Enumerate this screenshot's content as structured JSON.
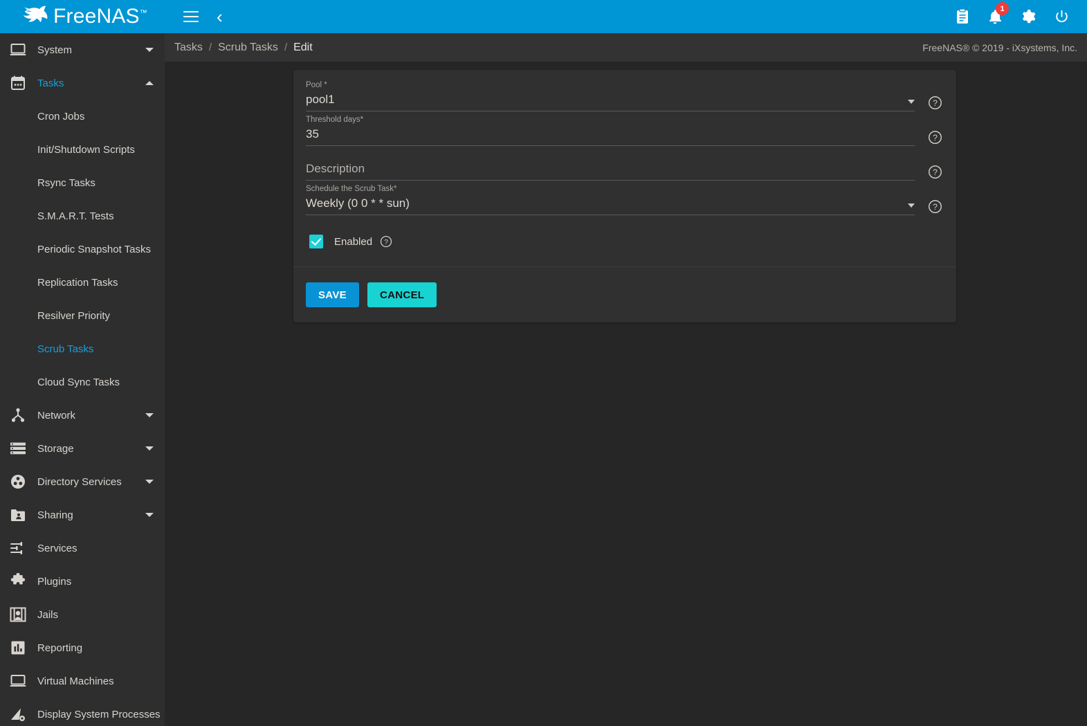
{
  "app": {
    "brand": "FreeNAS",
    "brand_tm": "™",
    "accent_blue": "#0095d5",
    "accent_cyan": "#19d2d2",
    "badge_red": "#f23b3b",
    "active_link": "#1a9fd9"
  },
  "topbar": {
    "menu_icon": "hamburger-icon",
    "collapse_icon": "chevron-left-icon",
    "icons": [
      {
        "name": "clipboard-icon",
        "label": "Tasks / Jobs"
      },
      {
        "name": "bell-icon",
        "label": "Alerts",
        "badge": "1"
      },
      {
        "name": "gear-icon",
        "label": "Settings"
      },
      {
        "name": "power-icon",
        "label": "Power"
      }
    ]
  },
  "sidebar": {
    "items": [
      {
        "label": "System",
        "icon": "monitor-icon",
        "expandable": true,
        "expanded": false,
        "active": false
      },
      {
        "label": "Tasks",
        "icon": "calendar-icon",
        "expandable": true,
        "expanded": true,
        "active": true
      }
    ],
    "task_children": [
      {
        "label": "Cron Jobs",
        "active": false
      },
      {
        "label": "Init/Shutdown Scripts",
        "active": false
      },
      {
        "label": "Rsync Tasks",
        "active": false
      },
      {
        "label": "S.M.A.R.T. Tests",
        "active": false
      },
      {
        "label": "Periodic Snapshot Tasks",
        "active": false
      },
      {
        "label": "Replication Tasks",
        "active": false
      },
      {
        "label": "Resilver Priority",
        "active": false
      },
      {
        "label": "Scrub Tasks",
        "active": true
      },
      {
        "label": "Cloud Sync Tasks",
        "active": false
      }
    ],
    "items_after": [
      {
        "label": "Network",
        "icon": "network-icon",
        "expandable": true
      },
      {
        "label": "Storage",
        "icon": "storage-icon",
        "expandable": true
      },
      {
        "label": "Directory Services",
        "icon": "directory-icon",
        "expandable": true
      },
      {
        "label": "Sharing",
        "icon": "sharing-icon",
        "expandable": true
      },
      {
        "label": "Services",
        "icon": "sliders-icon",
        "expandable": false
      },
      {
        "label": "Plugins",
        "icon": "puzzle-icon",
        "expandable": false
      },
      {
        "label": "Jails",
        "icon": "jail-icon",
        "expandable": false
      },
      {
        "label": "Reporting",
        "icon": "chart-icon",
        "expandable": false
      },
      {
        "label": "Virtual Machines",
        "icon": "vm-icon",
        "expandable": false
      },
      {
        "label": "Display System Processes",
        "icon": "processes-icon",
        "expandable": false
      }
    ]
  },
  "breadcrumb": {
    "items": [
      "Tasks",
      "Scrub Tasks",
      "Edit"
    ],
    "separator": "/",
    "copyright": "FreeNAS® © 2019 - iXsystems, Inc."
  },
  "form": {
    "pool": {
      "label": "Pool",
      "required_mark": "*",
      "value": "pool1",
      "help_icon": "help-circle-icon"
    },
    "threshold": {
      "label": "Threshold days",
      "required_mark": "*",
      "value": "35",
      "help_icon": "help-circle-icon"
    },
    "description": {
      "label": "",
      "placeholder": "Description",
      "value": "",
      "help_icon": "help-circle-icon"
    },
    "schedule": {
      "label": "Schedule the Scrub Task",
      "required_mark": "*",
      "value": "Weekly (0 0 * * sun)",
      "help_icon": "help-circle-icon"
    },
    "enabled": {
      "label": "Enabled",
      "checked": true,
      "help_icon": "help-circle-icon"
    },
    "save_label": "SAVE",
    "cancel_label": "CANCEL"
  }
}
